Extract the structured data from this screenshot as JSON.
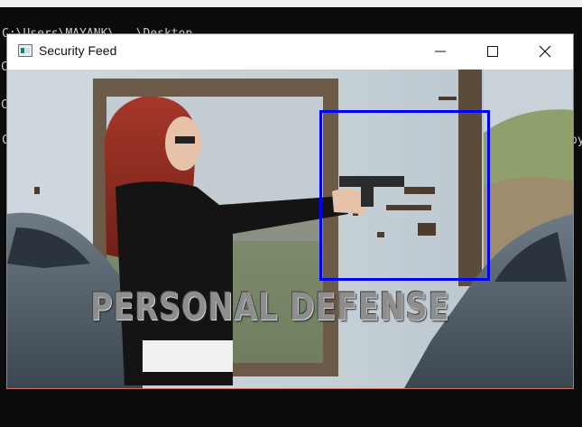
{
  "console": {
    "lines": [
      "C:\\Users\\MAYANK\\...\\Desktop",
      "C",
      "C",
      "C",
      "py"
    ]
  },
  "window": {
    "title": "Security Feed",
    "buttons": {
      "minimize": "minimize",
      "maximize": "maximize",
      "close": "close"
    }
  },
  "feed": {
    "caption": "PERSONAL DEFENSE",
    "detection_color": "#0000ff"
  }
}
